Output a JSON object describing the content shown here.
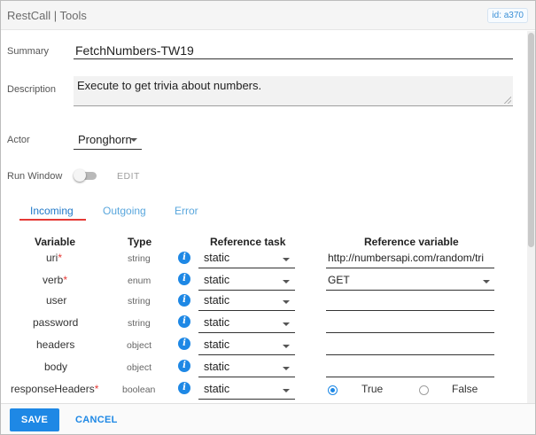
{
  "window": {
    "title": "RestCall | Tools",
    "id_badge": "id: a370"
  },
  "form": {
    "summary_label": "Summary",
    "summary_value": "FetchNumbers-TW19",
    "description_label": "Description",
    "description_value": "Execute to get trivia about numbers.",
    "actor_label": "Actor",
    "actor_value": "Pronghorn",
    "run_window_label": "Run Window",
    "run_window_on": false,
    "edit_label": "EDIT"
  },
  "tabs": [
    {
      "label": "Incoming",
      "active": true
    },
    {
      "label": "Outgoing",
      "active": false
    },
    {
      "label": "Error",
      "active": false
    }
  ],
  "table": {
    "headers": [
      "Variable",
      "Type",
      "Reference task",
      "Reference variable"
    ],
    "rows": [
      {
        "name": "uri",
        "required": "*",
        "type": "string",
        "ref_task": "static",
        "ref_var": "http://numbersapi.com/random/tri"
      },
      {
        "name": "verb",
        "required": "*",
        "type": "enum",
        "ref_task": "static",
        "ref_var": "GET"
      },
      {
        "name": "user",
        "required": "",
        "type": "string",
        "ref_task": "static",
        "ref_var": ""
      },
      {
        "name": "password",
        "required": "",
        "type": "string",
        "ref_task": "static",
        "ref_var": ""
      },
      {
        "name": "headers",
        "required": "",
        "type": "object",
        "ref_task": "static",
        "ref_var": ""
      },
      {
        "name": "body",
        "required": "",
        "type": "object",
        "ref_task": "static",
        "ref_var": ""
      },
      {
        "name": "responseHeaders",
        "required": "*",
        "type": "boolean",
        "ref_task": "static",
        "ref_var": ""
      }
    ],
    "boolean_options": {
      "true_label": "True",
      "false_label": "False",
      "selected": "True"
    }
  },
  "info_icon_glyph": "i",
  "footer": {
    "save_label": "SAVE",
    "cancel_label": "CANCEL"
  },
  "colors": {
    "accent": "#1e88e5",
    "required": "#e53935",
    "tab_underline": "#e53935"
  }
}
